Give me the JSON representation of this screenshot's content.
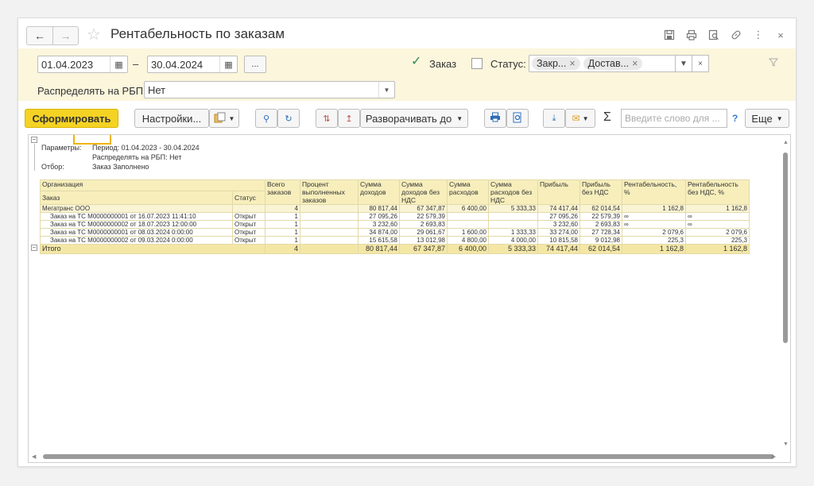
{
  "window": {
    "title": "Рентабельность по заказам"
  },
  "filters": {
    "date_from": "01.04.2023",
    "date_to": "30.04.2024",
    "dash": "–",
    "dots": "...",
    "order_label": "Заказ",
    "order_checked": true,
    "status_label": "Статус:",
    "status_checked": false,
    "status_tags": [
      "Закр...",
      "Достав..."
    ],
    "distribute_label": "Распределять на РБП:",
    "distribute_value": "Нет"
  },
  "toolbar": {
    "generate_label": "Сформировать",
    "settings_label": "Настройки...",
    "expand_label": "Разворачивать до",
    "search_placeholder": "Введите слово для ...",
    "help_label": "?",
    "more_label": "Еще",
    "sigma": "Σ"
  },
  "report": {
    "params_label": "Параметры:",
    "params_period": "Период: 01.04.2023 - 30.04.2024",
    "params_distribute": "Распределять на РБП: Нет",
    "filter_label": "Отбор:",
    "filter_value": "Заказ Заполнено",
    "headers": {
      "org": "Организация",
      "order": "Заказ",
      "status": "Статус",
      "total_orders": "Всего заказов",
      "percent_done": "Процент выполненных заказов",
      "income": "Сумма доходов",
      "income_no_vat": "Сумма доходов без НДС",
      "expense": "Сумма расходов",
      "expense_no_vat": "Сумма расходов без НДС",
      "profit": "Прибыль",
      "profit_no_vat": "Прибыль без НДС",
      "profitability": "Рентабельность, %",
      "profitability_no_vat": "Рентабельность без НДС, %"
    },
    "group_row": {
      "name": "Мегатранс ООО",
      "status": "",
      "total": "4",
      "percent": "",
      "income": "80 817,44",
      "income_nv": "67 347,87",
      "expense": "6 400,00",
      "expense_nv": "5 333,33",
      "profit": "74 417,44",
      "profit_nv": "62 014,54",
      "rent": "1 162,8",
      "rent_nv": "1 162,8"
    },
    "rows": [
      {
        "name": "Заказ на ТС М0000000001 от 16.07.2023 11:41:10",
        "status": "Открыт",
        "total": "1",
        "percent": "",
        "income": "27 095,26",
        "income_nv": "22 579,39",
        "expense": "",
        "expense_nv": "",
        "profit": "27 095,26",
        "profit_nv": "22 579,39",
        "rent": "∞",
        "rent_nv": "∞"
      },
      {
        "name": "Заказ на ТС М0000000002 от 18.07.2023 12:00:00",
        "status": "Открыт",
        "total": "1",
        "percent": "",
        "income": "3 232,60",
        "income_nv": "2 693,83",
        "expense": "",
        "expense_nv": "",
        "profit": "3 232,60",
        "profit_nv": "2 693,83",
        "rent": "∞",
        "rent_nv": "∞"
      },
      {
        "name": "Заказ на ТС М0000000001 от 08.03.2024 0:00:00",
        "status": "Открыт",
        "total": "1",
        "percent": "",
        "income": "34 874,00",
        "income_nv": "29 061,67",
        "expense": "1 600,00",
        "expense_nv": "1 333,33",
        "profit": "33 274,00",
        "profit_nv": "27 728,34",
        "rent": "2 079,6",
        "rent_nv": "2 079,6"
      },
      {
        "name": "Заказ на ТС М0000000002 от 09.03.2024 0:00:00",
        "status": "Открыт",
        "total": "1",
        "percent": "",
        "income": "15 615,58",
        "income_nv": "13 012,98",
        "expense": "4 800,00",
        "expense_nv": "4 000,00",
        "profit": "10 815,58",
        "profit_nv": "9 012,98",
        "rent": "225,3",
        "rent_nv": "225,3"
      }
    ],
    "total_row": {
      "name": "Итого",
      "total": "4",
      "income": "80 817,44",
      "income_nv": "67 347,87",
      "expense": "6 400,00",
      "expense_nv": "5 333,33",
      "profit": "74 417,44",
      "profit_nv": "62 014,54",
      "rent": "1 162,8",
      "rent_nv": "1 162,8"
    }
  }
}
